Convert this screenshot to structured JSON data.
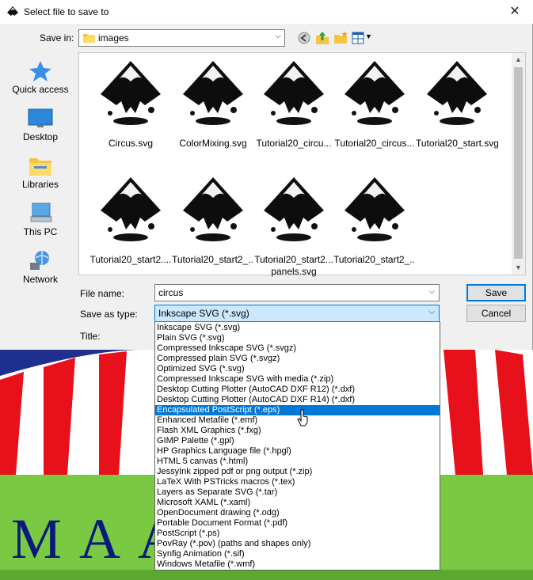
{
  "dialog": {
    "title": "Select file to save to",
    "save_in_label": "Save in:",
    "save_in_value": "images",
    "toolbar_icons": [
      "back-icon",
      "up-folder-icon",
      "new-folder-icon",
      "view-menu-icon"
    ]
  },
  "places": [
    {
      "label": "Quick access",
      "icon": "star-icon"
    },
    {
      "label": "Desktop",
      "icon": "desktop-icon"
    },
    {
      "label": "Libraries",
      "icon": "libraries-icon"
    },
    {
      "label": "This PC",
      "icon": "computer-icon"
    },
    {
      "label": "Network",
      "icon": "network-icon"
    }
  ],
  "files": [
    {
      "name": "Circus.svg"
    },
    {
      "name": "ColorMixing.svg"
    },
    {
      "name": "Tutorial20_circu..."
    },
    {
      "name": "Tutorial20_circus..."
    },
    {
      "name": "Tutorial20_start.svg"
    },
    {
      "name": "Tutorial20_start2...."
    },
    {
      "name": "Tutorial20_start2_..."
    },
    {
      "name": "Tutorial20_start2...",
      "name2": "panels.svg"
    },
    {
      "name": "Tutorial20_start2_..."
    }
  ],
  "form": {
    "file_name_label": "File name:",
    "file_name_value": "circus",
    "save_as_type_label": "Save as type:",
    "save_as_type_value": "Inkscape SVG (*.svg)",
    "title_label": "Title:",
    "save_button": "Save",
    "cancel_button": "Cancel"
  },
  "file_types": [
    "Inkscape SVG (*.svg)",
    "Plain SVG (*.svg)",
    "Compressed Inkscape SVG (*.svgz)",
    "Compressed plain SVG (*.svgz)",
    "Optimized SVG (*.svg)",
    "Compressed Inkscape SVG with media (*.zip)",
    "Desktop Cutting Plotter (AutoCAD DXF R12) (*.dxf)",
    "Desktop Cutting Plotter (AutoCAD DXF R14) (*.dxf)",
    "Encapsulated PostScript (*.eps)",
    "Enhanced Metafile (*.emf)",
    "Flash XML Graphics (*.fxg)",
    "GIMP Palette (*.gpl)",
    "HP Graphics Language file (*.hpgl)",
    "HTML 5 canvas (*.html)",
    "JessyInk zipped pdf or png output (*.zip)",
    "LaTeX With PSTricks macros (*.tex)",
    "Layers as Separate SVG (*.tar)",
    "Microsoft XAML (*.xaml)",
    "OpenDocument drawing (*.odg)",
    "Portable Document Format (*.pdf)",
    "PostScript (*.ps)",
    "PovRay (*.pov) (paths and shapes only)",
    "Synfig Animation (*.sif)",
    "Windows Metafile (*.wmf)"
  ],
  "highlighted_type": "Encapsulated PostScript (*.eps)",
  "background": {
    "title_text": "MAA      HT",
    "colors": {
      "sky": "#1f2f8f",
      "stripe_red": "#e8101a",
      "grass": "#7ac943",
      "title": "#0a1a7a"
    }
  },
  "colors": {
    "accent": "#0078d7",
    "selection": "#0078d7",
    "dialog_bg": "#f0f0f0"
  }
}
